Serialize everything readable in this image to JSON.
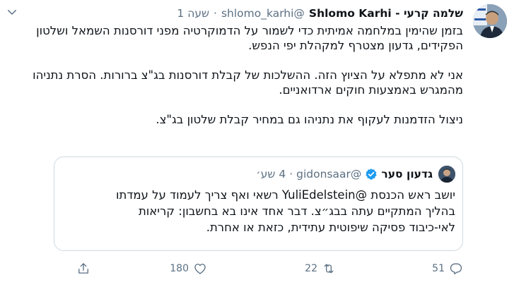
{
  "author": {
    "name": "שלמה קרעי - Shlomo Karhi",
    "handle": "@shlomo_karhi",
    "dot": "·",
    "time": "שעה 1"
  },
  "body": {
    "p1": "בזמן שהימין במלחמה אמיתית כדי לשמור על הדמוקרטיה מפני דורסנות השמאל ושלטון הפקידים, גדעון מצטרף למקהלת יפי הנפש.",
    "p2": "אני לא מתפלא על הציוץ הזה. ההשלכות של קבלת דורסנות בג\"צ ברורות. הסרת נתניהו מהמגרש באמצעות חוקים ארדואניים.",
    "p3": "ניצול הזדמנות לעקוף את נתניהו גם במחיר קבלת שלטון בג\"צ."
  },
  "quoted": {
    "name": "גדעון סער",
    "handle": "@gidonsaar",
    "dot": "·",
    "time": "4 שע׳",
    "line1_pre": "יושב ראש הכנסת ",
    "line1_mention": "@YuliEdelstein",
    "line1_post": " רשאי ואף צריך לעמוד על עמדתו",
    "line2": "בהליך המתקיים עתה בבג״צ. דבר אחד אינו בא בחשבון: קריאות",
    "line3": "לאי-כיבוד פסיקה שיפוטית עתידית, כזאת או אחרת."
  },
  "actions": {
    "reply_count": "51",
    "retweet_count": "22",
    "like_count": "180",
    "share_count": ""
  },
  "colors": {
    "text": "#0f1419",
    "secondary": "#5b7083",
    "verified": "#1d9bf0",
    "border": "#cfd9de"
  },
  "icons": {
    "reply": "reply-icon",
    "retweet": "retweet-icon",
    "like": "heart-icon",
    "share": "share-icon",
    "more": "chevron-down-icon"
  }
}
